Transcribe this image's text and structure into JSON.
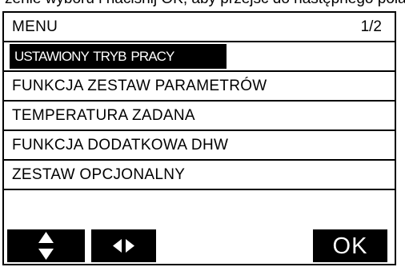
{
  "caption": {
    "text": "zenie wyboru i naciśnij OK, aby przejść do następnego pola"
  },
  "menu": {
    "title": "MENU",
    "page": "1/2",
    "selected_item": "USTAWIONY TRYB PRACY",
    "items": [
      "FUNKCJA ZESTAW PARAMETRÓW",
      "TEMPERATURA ZADANA",
      "FUNKCJA DODATKOWA DHW",
      "ZESTAW OPCJONALNY"
    ]
  },
  "buttons": {
    "up_down_icon": "up-down-arrows-icon",
    "left_right_icon": "left-right-arrows-icon",
    "ok_label": "OK"
  },
  "colors": {
    "background": "#ffffff",
    "foreground": "#000000",
    "highlight": "#000000",
    "highlight_text": "#ffffff"
  }
}
